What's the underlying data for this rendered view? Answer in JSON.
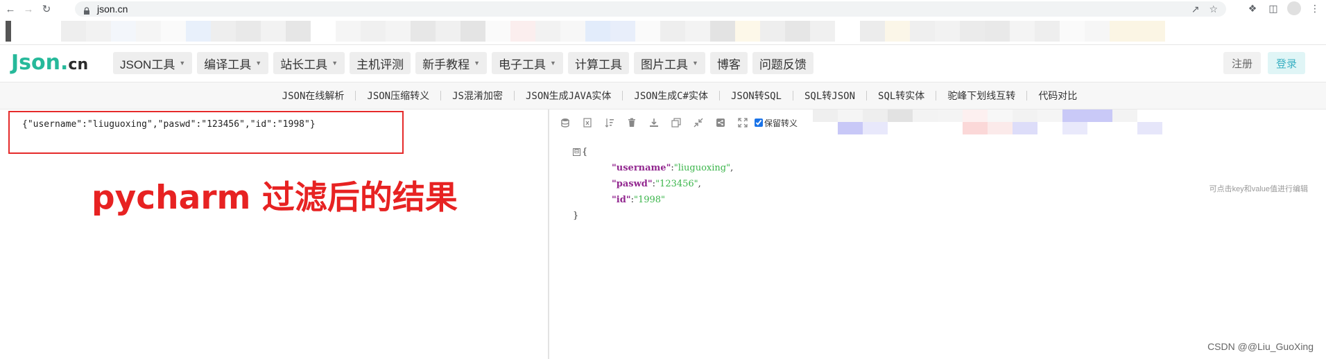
{
  "browser": {
    "url": "json.cn",
    "back_icon": "back-arrow-icon",
    "forward_icon": "forward-arrow-icon",
    "reload_icon": "reload-icon"
  },
  "site": {
    "logo_main": "Json",
    "logo_dot": ".",
    "logo_tld": "cn",
    "menu": [
      {
        "label": "JSON工具",
        "dropdown": true
      },
      {
        "label": "编译工具",
        "dropdown": true
      },
      {
        "label": "站长工具",
        "dropdown": true
      },
      {
        "label": "主机评测",
        "dropdown": false
      },
      {
        "label": "新手教程",
        "dropdown": true
      },
      {
        "label": "电子工具",
        "dropdown": true
      },
      {
        "label": "计算工具",
        "dropdown": false
      },
      {
        "label": "图片工具",
        "dropdown": true
      },
      {
        "label": "博客",
        "dropdown": false
      },
      {
        "label": "问题反馈",
        "dropdown": false
      }
    ],
    "register": "注册",
    "login": "登录"
  },
  "subnav": [
    "JSON在线解析",
    "JSON压缩转义",
    "JS混淆加密",
    "JSON生成JAVA实体",
    "JSON生成C#实体",
    "JSON转SQL",
    "SQL转JSON",
    "SQL转实体",
    "驼峰下划线互转",
    "代码对比"
  ],
  "editor": {
    "input": "{\"username\":\"liuguoxing\",\"paswd\":\"123456\",\"id\":\"1998\"}",
    "annotation": "pycharm 过滤后的结果"
  },
  "viewer": {
    "keep_escape_label": "保留转义",
    "keep_escape_checked": true,
    "open_brace": "{",
    "close_brace": "}",
    "collapse_symbol": "⊟",
    "entries": [
      {
        "key": "\"username\"",
        "value": "\"liuguoxing\"",
        "trail": ","
      },
      {
        "key": "\"paswd\"",
        "value": "\"123456\"",
        "trail": ","
      },
      {
        "key": "\"id\"",
        "value": "\"1998\"",
        "trail": ""
      }
    ],
    "hint": "可点击key和value值进行编辑"
  },
  "watermark": "CSDN @@Liu_GuoXing",
  "colors": {
    "brand": "#26b99a",
    "annotation_red": "#e72222",
    "json_key": "#92278f",
    "json_value": "#3ab54a"
  }
}
